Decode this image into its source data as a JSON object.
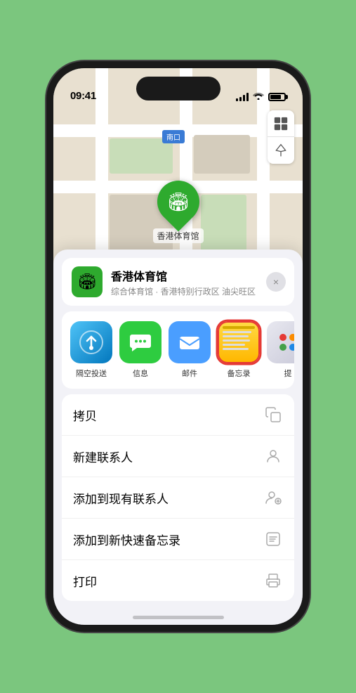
{
  "status_bar": {
    "time": "09:41",
    "navigation_icon": "▶"
  },
  "map": {
    "south_entrance_label": "南口",
    "location_name": "香港体育馆",
    "pin_emoji": "🏟"
  },
  "place_card": {
    "name": "香港体育馆",
    "subtitle": "综合体育馆 · 香港特别行政区 油尖旺区",
    "close_label": "×"
  },
  "share_items": [
    {
      "id": "airdrop",
      "type": "airdrop",
      "label": "隔空投送"
    },
    {
      "id": "messages",
      "type": "messages",
      "label": "信息"
    },
    {
      "id": "mail",
      "type": "mail",
      "label": "邮件"
    },
    {
      "id": "notes",
      "type": "notes",
      "label": "备忘录"
    },
    {
      "id": "more",
      "type": "more",
      "label": "提"
    }
  ],
  "action_items": [
    {
      "id": "copy",
      "text": "拷贝",
      "icon": "copy"
    },
    {
      "id": "new-contact",
      "text": "新建联系人",
      "icon": "person"
    },
    {
      "id": "add-existing",
      "text": "添加到现有联系人",
      "icon": "person-add"
    },
    {
      "id": "add-quick-note",
      "text": "添加到新快速备忘录",
      "icon": "note"
    },
    {
      "id": "print",
      "text": "打印",
      "icon": "print"
    }
  ]
}
